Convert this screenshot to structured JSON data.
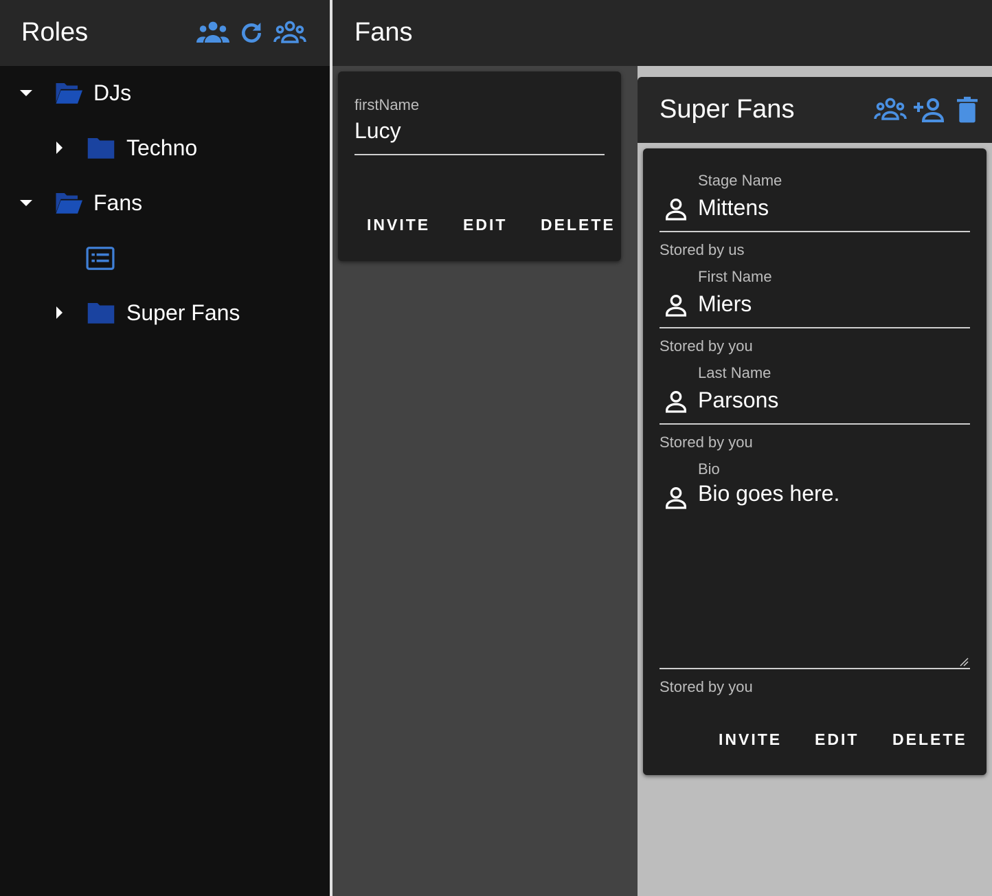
{
  "left_panel": {
    "title": "Roles",
    "header_icons": [
      "groups-icon",
      "refresh-icon",
      "groups-outline-icon"
    ],
    "tree": [
      {
        "label": "DJs",
        "expanded": true,
        "level": 0
      },
      {
        "label": "Techno",
        "expanded": false,
        "level": 1
      },
      {
        "label": "Fans",
        "expanded": true,
        "level": 0
      },
      {
        "label": "",
        "level": 1,
        "type": "card-icon"
      },
      {
        "label": "Super Fans",
        "expanded": false,
        "level": 1
      }
    ]
  },
  "main": {
    "title": "Fans",
    "card": {
      "field_label": "firstName",
      "field_value": "Lucy",
      "invite_label": "INVITE",
      "edit_label": "EDIT",
      "delete_label": "DELETE"
    }
  },
  "detail": {
    "title": "Super Fans",
    "header_icons": [
      "groups-icon",
      "person-add-icon",
      "delete-icon"
    ],
    "fields": [
      {
        "label": "Stage Name",
        "value": "Mittens",
        "helper": "Stored by us"
      },
      {
        "label": "First Name",
        "value": "Miers",
        "helper": "Stored by you"
      },
      {
        "label": "Last Name",
        "value": "Parsons",
        "helper": "Stored by you"
      },
      {
        "label": "Bio",
        "value": "Bio goes here.",
        "helper": "Stored by you"
      }
    ],
    "invite_label": "INVITE",
    "edit_label": "EDIT",
    "delete_label": "DELETE"
  },
  "colors": {
    "accent": "#4a90e2",
    "folder": "#1a43a0",
    "panel_header": "#272727",
    "card": "#1f1f1f"
  }
}
